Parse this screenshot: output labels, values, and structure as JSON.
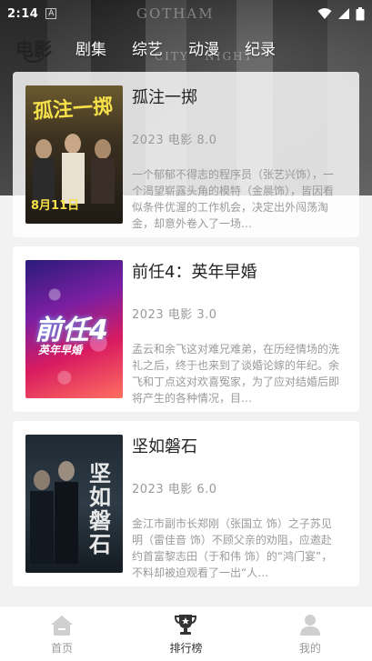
{
  "status_bar": {
    "time": "2:14",
    "indicator": "A"
  },
  "tabs": [
    {
      "label": "电影",
      "active": true
    },
    {
      "label": "剧集",
      "active": false
    },
    {
      "label": "综艺",
      "active": false
    },
    {
      "label": "动漫",
      "active": false
    },
    {
      "label": "纪录",
      "active": false
    }
  ],
  "movies": [
    {
      "title": "孤注一掷",
      "meta": "2023 电影 8.0",
      "desc": "一个郁郁不得志的程序员（张艺兴饰），一个渴望崭露头角的模特（金晨饰），皆因看似条件优渥的工作机会，决定出外闯荡淘金，却意外卷入了一场…",
      "poster_text": "孤注一掷",
      "poster_date": "8月11日"
    },
    {
      "title": "前任4：英年早婚",
      "meta": "2023 电影 3.0",
      "desc": "孟云和余飞这对难兄难弟，在历经情场的洗礼之后，终于也来到了谈婚论嫁的年纪。余飞和丁点这对欢喜冤家，为了应对结婚后即将产生的各种情况，目…",
      "poster_text": "前任4",
      "poster_sub": "英年早婚"
    },
    {
      "title": "坚如磐石",
      "meta": "2023 电影 6.0",
      "desc": "金江市副市长郑刚（张国立 饰）之子苏见明（雷佳音 饰）不顾父亲的劝阻，应邀赴约首富黎志田（于和伟 饰）的“鸿门宴”，不料却被迫观看了一出“人…",
      "poster_text": "坚如磐石"
    }
  ],
  "bottom_nav": [
    {
      "label": "首页",
      "icon": "home-icon",
      "active": false
    },
    {
      "label": "排行榜",
      "icon": "trophy-icon",
      "active": true
    },
    {
      "label": "我的",
      "icon": "person-icon",
      "active": false
    }
  ],
  "colors": {
    "active_text": "#222222",
    "muted_text": "#9a9a9a",
    "card_bg": "#ffffff",
    "page_bg": "#f2f2f2"
  }
}
